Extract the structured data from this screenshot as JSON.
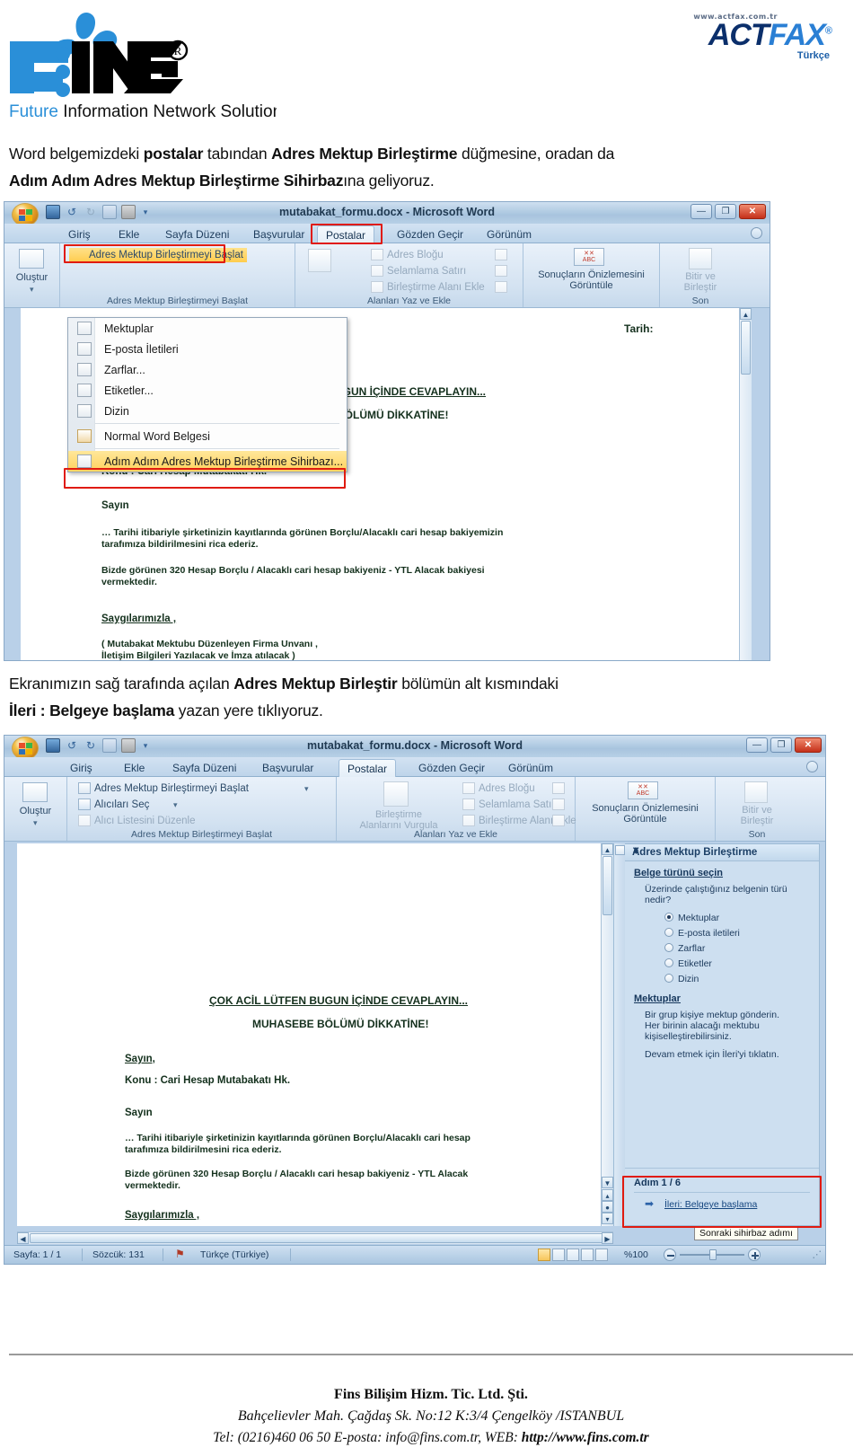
{
  "header": {
    "fins_logo_alt": "FINS",
    "fins_tagline": "Future Information Network Solutions",
    "actfax_url": "www.actfax.com.tr",
    "actfax_act": "ACT",
    "actfax_fax": "FAX",
    "actfax_lang": "Türkçe"
  },
  "paragraphs": {
    "p1_a": "Word belgemizdeki ",
    "p1_b1": "postalar",
    "p1_c": " tabından ",
    "p1_b2": "Adres Mektup Birleştirme",
    "p1_d": " düğmesine, oradan da",
    "p1_e_b": "Adım Adım Adres Mektup Birleştirme Sihirbaz",
    "p1_e": "ına geliyoruz.",
    "p2_a": "Ekranımızın sağ tarafında açılan ",
    "p2_b1": "Adres Mektup Birleştir",
    "p2_c": " bölümün alt kısmındaki",
    "p2_b2": "İleri : Belgeye başlama",
    "p2_d": " yazan yere tıklıyoruz."
  },
  "word": {
    "title": "mutabakat_formu.docx - Microsoft Word",
    "tabs": [
      "Giriş",
      "Ekle",
      "Sayfa Düzeni",
      "Başvurular",
      "Postalar",
      "Gözden Geçir",
      "Görünüm"
    ],
    "active_tab": "Postalar",
    "window_controls": {
      "minimize": "—",
      "maximize": "❐",
      "close": "✕"
    },
    "ribbon": {
      "create_group_label": "Oluştur",
      "start_merge_button": "Adres Mektup Birleştirmeyi Başlat",
      "select_recipients": "Alıcıları Seç",
      "edit_recipient_list": "Alıcı Listesini Düzenle",
      "start_group_label": "Adres Mektup Birleştirmeyi Başlat",
      "highlight_fields": "Birleştirme Alanlarını Vurgula",
      "highlight_fields_l1": "Birleştirme",
      "highlight_fields_l2": "Alanlarını Vurgula",
      "address_block": "Adres Bloğu",
      "greeting_line": "Selamlama Satırı",
      "insert_merge_field": "Birleştirme Alanı Ekle",
      "write_insert_group_label": "Alanları Yaz ve Ekle",
      "preview_results_l1": "Sonuçların Önizlemesini",
      "preview_results_l2": "Görüntüle",
      "preview_icon_label": "ABC",
      "finish_merge_l1": "Bitir ve",
      "finish_merge_l2": "Birleştir",
      "finish_group_label": "Son"
    },
    "dropdown": {
      "items": [
        {
          "label": "Mektuplar",
          "accel": "M"
        },
        {
          "label": "E-posta İletileri",
          "accel": "E"
        },
        {
          "label": "Zarflar...",
          "accel": "Z"
        },
        {
          "label": "Etiketler...",
          "accel": "t"
        },
        {
          "label": "Dizin",
          "accel": "D"
        },
        {
          "label": "Normal Word Belgesi",
          "accel": "W"
        },
        {
          "label": "Adım Adım Adres Mektup Birleştirme Sihirbazı...",
          "accel": "z"
        }
      ],
      "selected_index": 6
    },
    "document": {
      "date_label": "Tarih:",
      "line_urgent": "ÇOK ACİL LÜTFEN BUGUN İÇİNDE CEVAPLAYIN...",
      "line_dept": "MUHASEBE BÖLÜMÜ DİKKATİNE!",
      "line_sayin1": "Sayın,",
      "line_konu": "Konu : Cari Hesap Mutabakatı Hk.",
      "line_sayin2": "Sayın",
      "para1_l1": "… Tarihi itibariyle şirketinizin kayıtlarında görünen Borçlu/Alacaklı cari hesap bakiyemizin",
      "para1_l2": "tarafımıza bildirilmesini rica ederiz.",
      "para2_l1": "Bizde görünen 320 Hesap Borçlu / Alacaklı cari hesap bakiyeniz   - YTL Alacak bakiyesi",
      "para2_l2": "vermektedir.",
      "line_regards": "Saygılarımızla ,",
      "closing_l1": "( Mutabakat Mektubu Düzenleyen Firma Unvanı ,",
      "closing_l2": "İletişim Bilgileri Yazılacak ve İmza atılacak  )",
      "para2_l1_short": "Bizde görünen 320 Hesap Borçlu / Alacaklı cari hesap bakiyeniz   - YTL Alacak",
      "para1_l1_short": "… Tarihi itibariyle şirketinizin kayıtlarında görünen Borçlu/Alacaklı cari hesap"
    },
    "taskpane": {
      "title": "Adres Mektup Birleştirme",
      "collapse_glyph": "▼",
      "close_glyph": "✕",
      "section1_head": "Belge türünü seçin",
      "section1_question_l1": "Üzerinde çalıştığınız belgenin türü",
      "section1_question_l2": "nedir?",
      "options": [
        "Mektuplar",
        "E-posta iletileri",
        "Zarflar",
        "Etiketler",
        "Dizin"
      ],
      "selected_option": "Mektuplar",
      "section2_head": "Mektuplar",
      "section2_l1": "Bir grup kişiye mektup gönderin.",
      "section2_l2": "Her birinin alacağı mektubu",
      "section2_l3": "kişiselleştirebilirsiniz.",
      "section2_l4": "Devam etmek için İleri'yi tıklatın.",
      "step_label": "Adım 1 / 6",
      "next_link": "İleri: Belgeye başlama",
      "next_arrow": "➡",
      "tooltip": "Sonraki sihirbaz adımı"
    },
    "statusbar": {
      "page": "Sayfa: 1 / 1",
      "words": "Sözcük: 131",
      "language": "Türkçe (Türkiye)",
      "zoom": "%100"
    }
  },
  "footer": {
    "company": "Fins Bilişim Hizm. Tic. Ltd. Şti.",
    "address": "Bahçelievler Mah. Çağdaş Sk. No:12 K:3/4 Çengelköy /ISTANBUL",
    "contact_pre": "Tel: (0216)460 06 50  E-posta: info@fins.com.tr, WEB: ",
    "website": "http://www.fins.com.tr"
  },
  "colors": {
    "accent_red": "#e01b10",
    "brand_blue": "#2a7fd4",
    "highlight_gold": "#ffcc4d"
  }
}
